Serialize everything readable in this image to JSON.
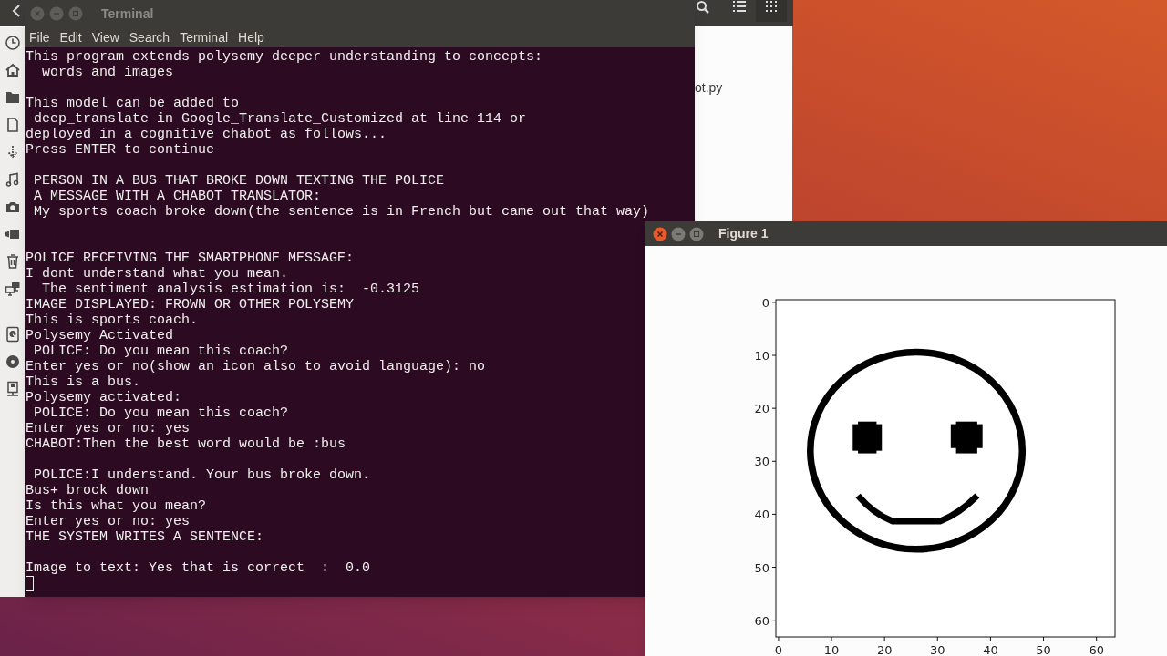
{
  "file_manager": {
    "file_name": "ot.py"
  },
  "terminal": {
    "title": "Terminal",
    "active": false,
    "menu": [
      "File",
      "Edit",
      "View",
      "Search",
      "Terminal",
      "Help"
    ],
    "blocks": [
      {
        "wide_gap_before": false,
        "lines": [
          "This program extends polysemy deeper understanding to concepts:",
          "  words and images"
        ]
      },
      {
        "wide_gap_before": false,
        "lines": [
          "This model can be added to",
          " deep_translate in Google_Translate_Customized at line 114 or",
          "deployed in a cognitive chabot as follows...",
          "Press ENTER to continue"
        ]
      },
      {
        "wide_gap_before": false,
        "lines": [
          " PERSON IN A BUS THAT BROKE DOWN TEXTING THE POLICE",
          " A MESSAGE WITH A CHABOT TRANSLATOR:",
          " My sports coach broke down(the sentence is in French but came out that way)"
        ]
      },
      {
        "wide_gap_before": true,
        "lines": [
          "POLICE RECEIVING THE SMARTPHONE MESSAGE:",
          "I dont understand what you mean.",
          "  The sentiment analysis estimation is:  -0.3125",
          "IMAGE DISPLAYED: FROWN OR OTHER POLYSEMY",
          "This is sports coach.",
          "Polysemy Activated",
          " POLICE: Do you mean this coach?",
          "Enter yes or no(show an icon also to avoid language): no",
          "This is a bus.",
          "Polysemy activated:",
          " POLICE: Do you mean this coach?",
          "Enter yes or no: yes",
          "CHABOT:Then the best word would be :bus"
        ]
      },
      {
        "wide_gap_before": false,
        "lines": [
          " POLICE:I understand. Your bus broke down.",
          "Bus+ brock down",
          "Is this what you mean?",
          "Enter yes or no: yes",
          "THE SYSTEM WRITES A SENTENCE:"
        ]
      },
      {
        "wide_gap_before": false,
        "lines": [
          "Image to text: Yes that is correct  :  0.0"
        ]
      }
    ],
    "cursor": true
  },
  "figure": {
    "title": "Figure 1",
    "active": true,
    "y_ticks": [
      "0",
      "10",
      "20",
      "30",
      "40",
      "50",
      "60"
    ],
    "x_ticks": [
      "0",
      "10",
      "20",
      "30",
      "40",
      "50",
      "60"
    ]
  }
}
